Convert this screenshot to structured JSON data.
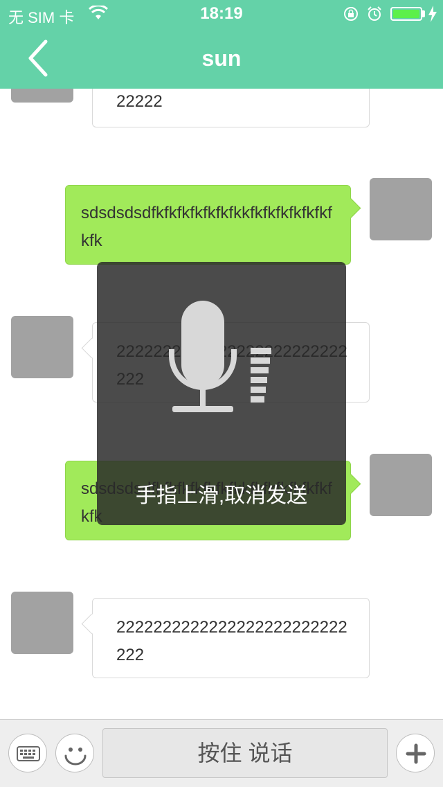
{
  "status_bar": {
    "carrier": "无 SIM 卡",
    "time": "18:19"
  },
  "nav": {
    "title": "sun"
  },
  "messages": [
    {
      "side": "in",
      "text": "22222"
    },
    {
      "side": "out",
      "text": "sdsdsdsdfkfkfkfkfkfkfkkfkfkfkfkfkfkfkfk"
    },
    {
      "side": "in",
      "text": "2222222222222222222222222222"
    },
    {
      "side": "out",
      "text": "sdsdsdsdfkfkfkfkfkfkfkkfkfkfkfkfkfkfkfk"
    },
    {
      "side": "in",
      "text": "2222222222222222222222222222"
    }
  ],
  "recording": {
    "hint": "手指上滑,取消发送"
  },
  "input_bar": {
    "talk_label": "按住 说话"
  },
  "colors": {
    "nav_bg": "#64d2a8",
    "outgoing_bubble": "#a1ea5a",
    "avatar": "#a2a2a2"
  }
}
